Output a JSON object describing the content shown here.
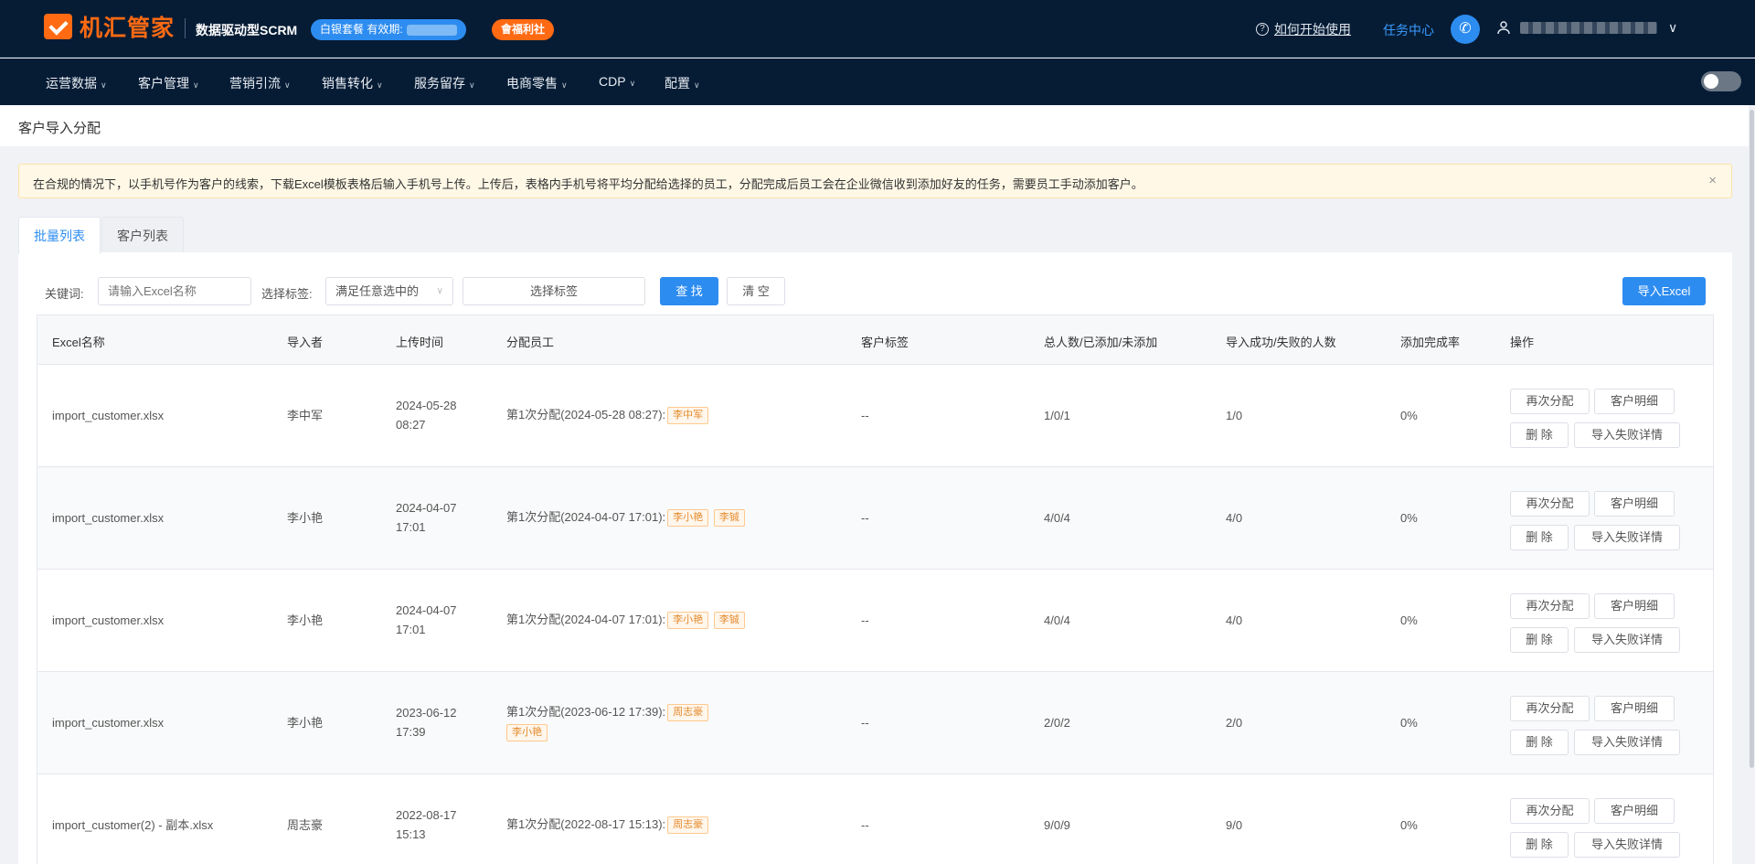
{
  "header": {
    "logo_text": "机汇管家",
    "tagline": "数据驱动型SCRM",
    "plan_badge": "白银套餐 有效期:",
    "welfare_badge": "會福利社",
    "help_label": "如何开始使用",
    "task_center": "任务中心",
    "user_caret": "∨"
  },
  "nav": {
    "items": [
      {
        "label": "运营数据"
      },
      {
        "label": "客户管理"
      },
      {
        "label": "营销引流"
      },
      {
        "label": "销售转化"
      },
      {
        "label": "服务留存"
      },
      {
        "label": "电商零售"
      },
      {
        "label": "CDP"
      },
      {
        "label": "配置"
      }
    ]
  },
  "breadcrumb": "客户导入分配",
  "notice": {
    "text": "在合规的情况下，以手机号作为客户的线索，下载Excel模板表格后输入手机号上传。上传后，表格内手机号将平均分配给选择的员工，分配完成后员工会在企业微信收到添加好友的任务，需要员工手动添加客户。",
    "close": "×"
  },
  "tabs": [
    {
      "label": "批量列表",
      "active": true
    },
    {
      "label": "客户列表",
      "active": false
    }
  ],
  "filters": {
    "keyword_label": "关键词:",
    "keyword_placeholder": "请输入Excel名称",
    "tag_label": "选择标签:",
    "tag_mode": "满足任意选中的",
    "tag_select": "选择标签",
    "search_btn": "查 找",
    "clear_btn": "清 空",
    "import_btn": "导入Excel"
  },
  "table": {
    "columns": [
      "Excel名称",
      "导入者",
      "上传时间",
      "分配员工",
      "客户标签",
      "总人数/已添加/未添加",
      "导入成功/失败的人数",
      "添加完成率",
      "操作"
    ],
    "rows": [
      {
        "name": "import_customer.xlsx",
        "importer": "李中军",
        "date": "2024-05-28",
        "time": "08:27",
        "assign": "第1次分配(2024-05-28 08:27):",
        "staff1": "李中军",
        "staff2": "",
        "tags": "--",
        "totals": "1/0/1",
        "result": "1/0",
        "rate": "0%"
      },
      {
        "name": "import_customer.xlsx",
        "importer": "李小艳",
        "date": "2024-04-07",
        "time": "17:01",
        "assign": "第1次分配(2024-04-07 17:01):",
        "staff1": "李小艳",
        "staff2": "李铖",
        "tags": "--",
        "totals": "4/0/4",
        "result": "4/0",
        "rate": "0%"
      },
      {
        "name": "import_customer.xlsx",
        "importer": "李小艳",
        "date": "2024-04-07",
        "time": "17:01",
        "assign": "第1次分配(2024-04-07 17:01):",
        "staff1": "李小艳",
        "staff2": "李铖",
        "tags": "--",
        "totals": "4/0/4",
        "result": "4/0",
        "rate": "0%"
      },
      {
        "name": "import_customer.xlsx",
        "importer": "李小艳",
        "date": "2023-06-12",
        "time": "17:39",
        "assign": "第1次分配(2023-06-12 17:39):",
        "staff1": "周志豪",
        "staff2": "李小艳",
        "tags": "--",
        "totals": "2/0/2",
        "result": "2/0",
        "rate": "0%"
      },
      {
        "name": "import_customer(2) - 副本.xlsx",
        "importer": "周志豪",
        "date": "2022-08-17",
        "time": "15:13",
        "assign": "第1次分配(2022-08-17 15:13):",
        "staff1": "周志豪",
        "staff2": "",
        "tags": "--",
        "totals": "9/0/9",
        "result": "9/0",
        "rate": "0%"
      }
    ],
    "ops": {
      "reassign": "再次分配",
      "detail": "客户明细",
      "delete": "删 除",
      "fail_detail": "导入失败详情"
    }
  }
}
